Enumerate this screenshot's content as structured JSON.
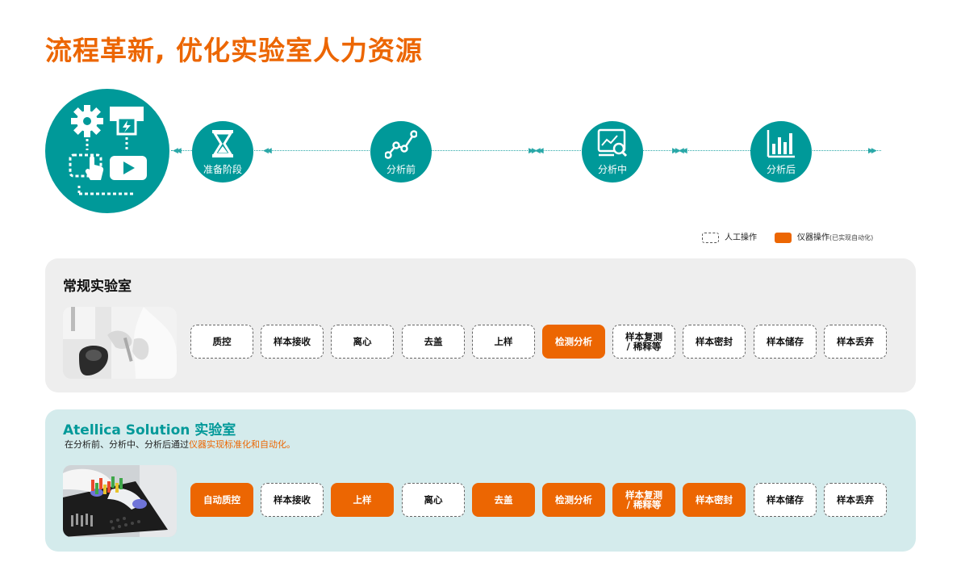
{
  "title": "流程革新, 优化实验室人力资源",
  "colors": {
    "accent": "#ec6602",
    "teal": "#009999",
    "regular_bg": "#eeeeee",
    "atellica_bg": "#d4ebec"
  },
  "stages": [
    {
      "label": "准备阶段",
      "icon": "hourglass-icon"
    },
    {
      "label": "分析前",
      "icon": "line-graph-icon"
    },
    {
      "label": "分析中",
      "icon": "monitor-search-icon"
    },
    {
      "label": "分析后",
      "icon": "bar-chart-icon"
    }
  ],
  "legend": {
    "manual": "人工操作",
    "auto": "仪器操作",
    "auto_note": "(已实现自动化)"
  },
  "regular_lab": {
    "title": "常规实验室",
    "steps": [
      {
        "label": "质控",
        "type": "manual"
      },
      {
        "label": "样本接收",
        "type": "manual"
      },
      {
        "label": "离心",
        "type": "manual"
      },
      {
        "label": "去盖",
        "type": "manual"
      },
      {
        "label": "上样",
        "type": "manual"
      },
      {
        "label": "检测分析",
        "type": "auto"
      },
      {
        "label": "样本复测\n/ 稀释等",
        "type": "manual"
      },
      {
        "label": "样本密封",
        "type": "manual"
      },
      {
        "label": "样本储存",
        "type": "manual"
      },
      {
        "label": "样本丢弃",
        "type": "manual"
      }
    ]
  },
  "atellica_lab": {
    "title": "Atellica Solution 实验室",
    "subtitle_plain": "在分析前、分析中、分析后通过",
    "subtitle_highlight": "仪器实现标准化和自动化。",
    "steps": [
      {
        "label": "自动质控",
        "type": "auto"
      },
      {
        "label": "样本接收",
        "type": "manual"
      },
      {
        "label": "上样",
        "type": "auto"
      },
      {
        "label": "离心",
        "type": "manual"
      },
      {
        "label": "去盖",
        "type": "auto"
      },
      {
        "label": "检测分析",
        "type": "auto"
      },
      {
        "label": "样本复测\n/ 稀释等",
        "type": "auto"
      },
      {
        "label": "样本密封",
        "type": "auto"
      },
      {
        "label": "样本储存",
        "type": "manual"
      },
      {
        "label": "样本丢弃",
        "type": "manual"
      }
    ]
  }
}
